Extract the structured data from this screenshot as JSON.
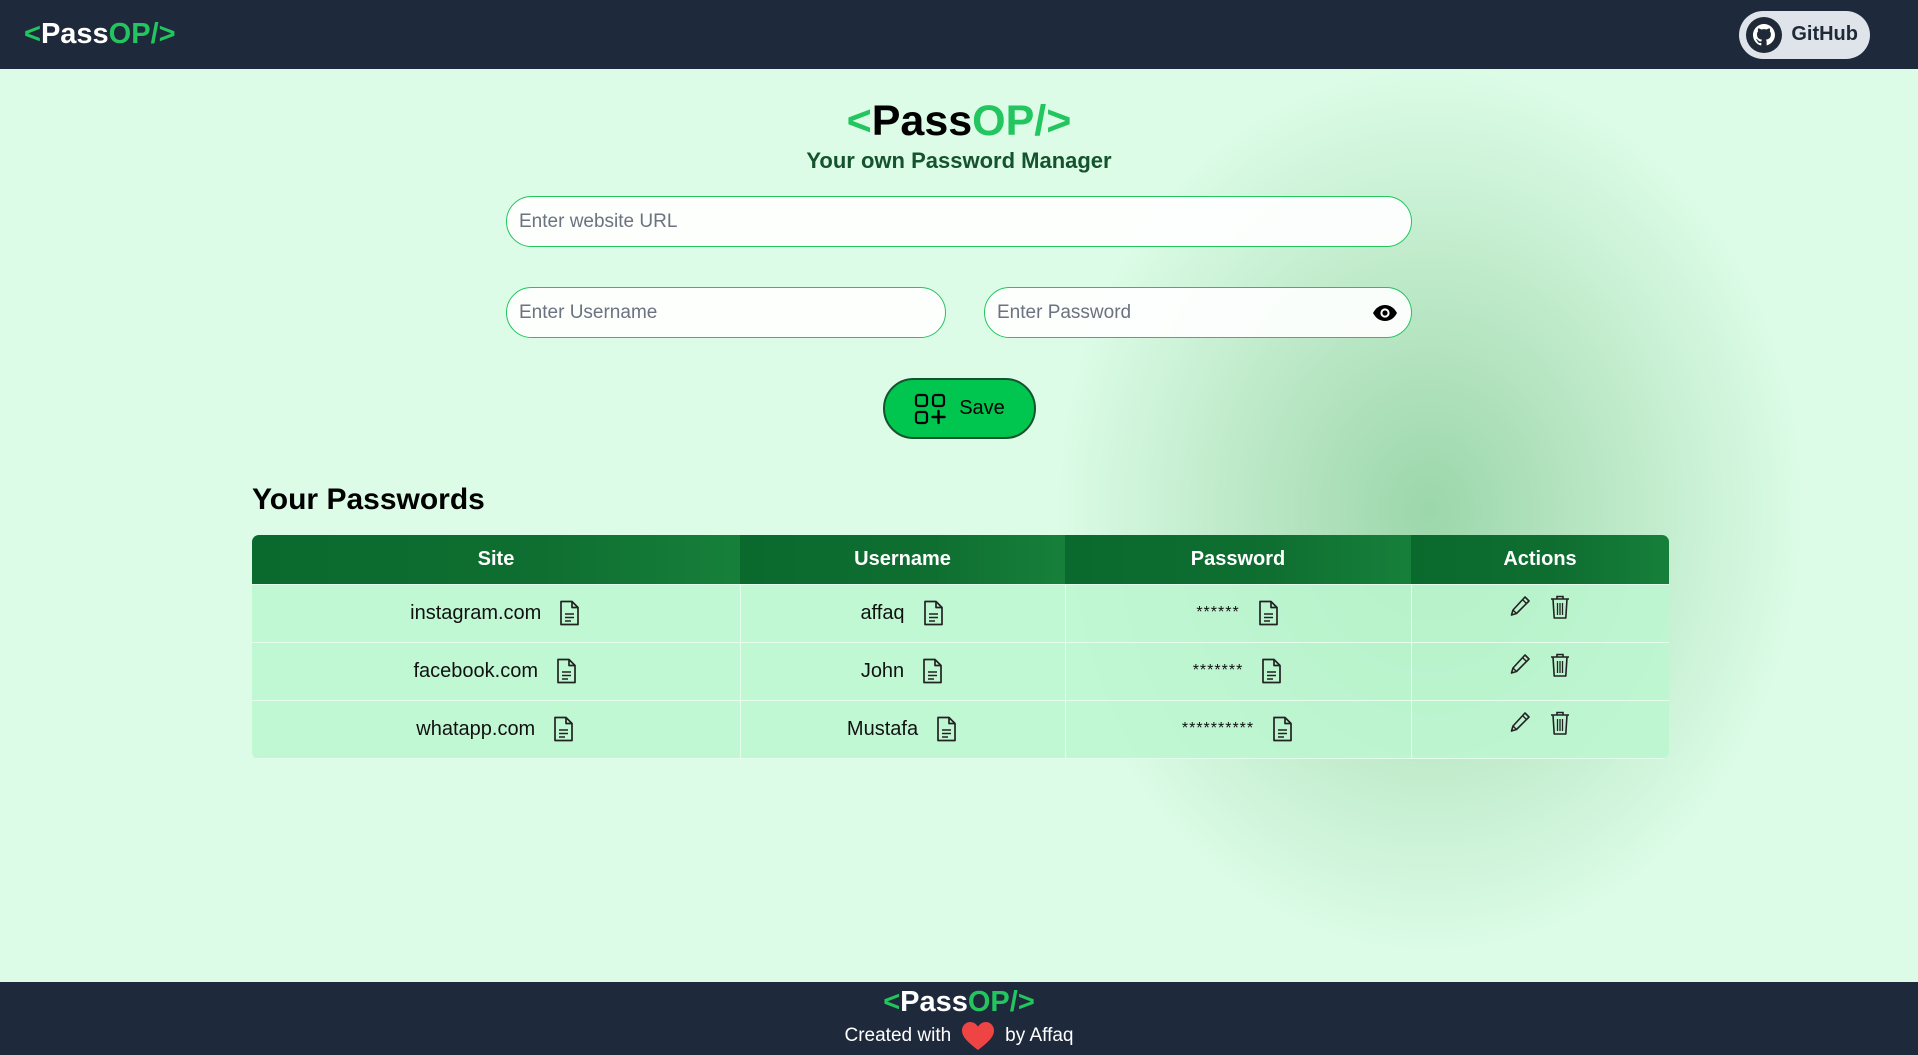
{
  "brand": {
    "lt": "<",
    "pass": "Pass",
    "op": "OP/",
    "gt": ">"
  },
  "nav": {
    "github_label": "GitHub"
  },
  "hero": {
    "subtitle": "Your own Password Manager"
  },
  "form": {
    "url_placeholder": "Enter website URL",
    "username_placeholder": "Enter Username",
    "password_placeholder": "Enter Password",
    "save_label": "Save"
  },
  "passwords": {
    "title": "Your Passwords",
    "columns": [
      "Site",
      "Username",
      "Password",
      "Actions"
    ],
    "rows": [
      {
        "site": "instagram.com",
        "username": "affaq",
        "password": "******"
      },
      {
        "site": "facebook.com",
        "username": "John",
        "password": "*******"
      },
      {
        "site": "whatapp.com",
        "username": "Mustafa",
        "password": "**********"
      }
    ]
  },
  "footer": {
    "created_with": "Created with",
    "by": "by Affaq"
  },
  "colors": {
    "accent": "#22c55e",
    "nav_bg": "#1e293b",
    "page_bg": "#dcfce7",
    "save_bg": "#00c64f",
    "table_head": "#0f6f31",
    "heart": "#ef4444"
  }
}
